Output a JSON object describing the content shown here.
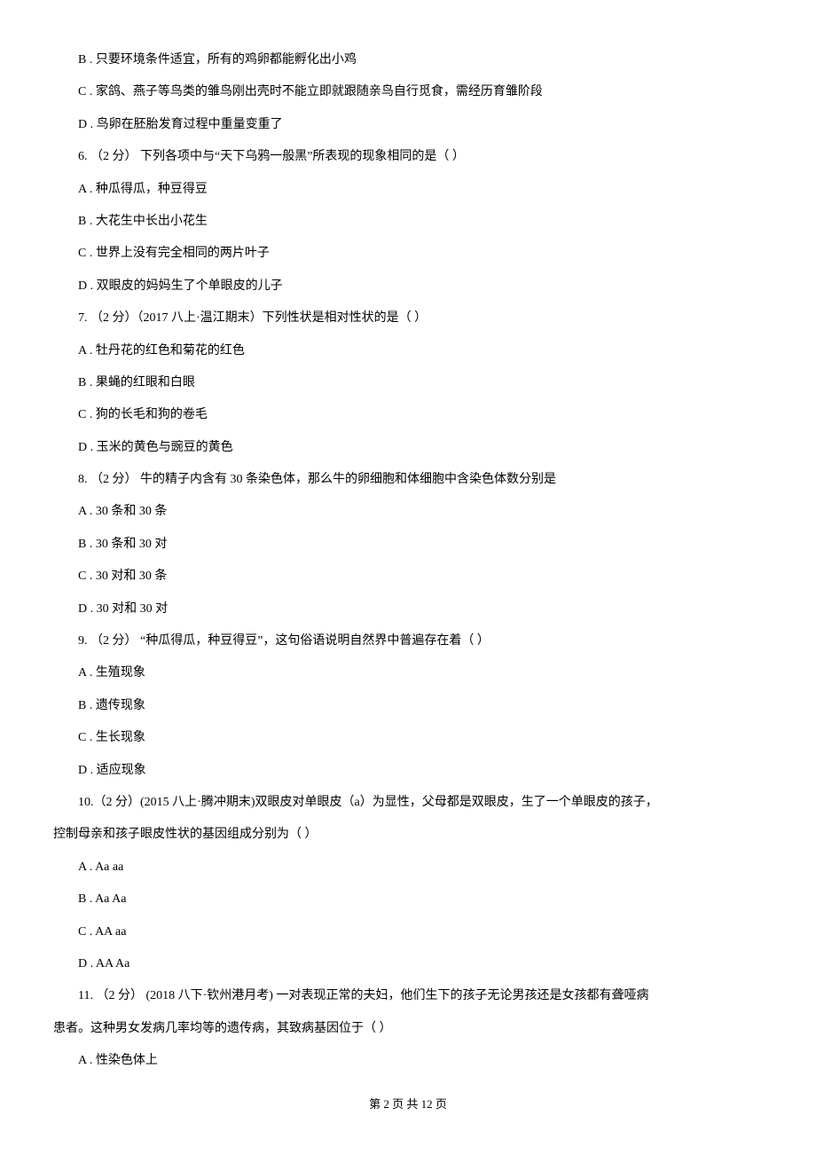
{
  "lines": [
    "B . 只要环境条件适宜，所有的鸡卵都能孵化出小鸡",
    "C . 家鸽、燕子等鸟类的雏鸟刚出壳时不能立即就跟随亲鸟自行觅食，需经历育雏阶段",
    "D . 鸟卵在胚胎发育过程中重量变重了",
    "6. （2 分） 下列各项中与“天下乌鸦一般黑”所表现的现象相同的是（    ）",
    "A . 种瓜得瓜，种豆得豆",
    "B . 大花生中长出小花生",
    "C . 世界上没有完全相同的两片叶子",
    "D . 双眼皮的妈妈生了个单眼皮的儿子",
    "7. （2 分）（2017 八上·温江期末）下列性状是相对性状的是（    ）",
    "A . 牡丹花的红色和菊花的红色",
    "B . 果蝇的红眼和白眼",
    "C . 狗的长毛和狗的卷毛",
    "D . 玉米的黄色与豌豆的黄色",
    "8. （2 分） 牛的精子内含有 30 条染色体，那么牛的卵细胞和体细胞中含染色体数分别是",
    "A . 30 条和 30 条",
    "B . 30 条和 30 对",
    "C . 30 对和 30 条",
    "D . 30 对和 30 对",
    "9. （2 分） “种瓜得瓜，种豆得豆”，这句俗语说明自然界中普遍存在着（    ）",
    "A . 生殖现象",
    "B . 遗传现象",
    "C . 生长现象",
    "D . 适应现象",
    "10.（2 分）(2015 八上·腾冲期末)双眼皮对单眼皮（a）为显性，父母都是双眼皮，生了一个单眼皮的孩子，",
    "控制母亲和孩子眼皮性状的基因组成分别为（    ）",
    "A . Aa    aa",
    "B . Aa     Aa",
    "C . AA    aa",
    "D . AA    Aa",
    "11. （2 分） (2018 八下·钦州港月考) 一对表现正常的夫妇，他们生下的孩子无论男孩还是女孩都有聋哑病",
    "患者。这种男女发病几率均等的遗传病，其致病基因位于（    ）",
    "A . 性染色体上"
  ],
  "noIndentIndices": [
    24,
    30
  ],
  "footer": "第 2 页 共 12 页"
}
